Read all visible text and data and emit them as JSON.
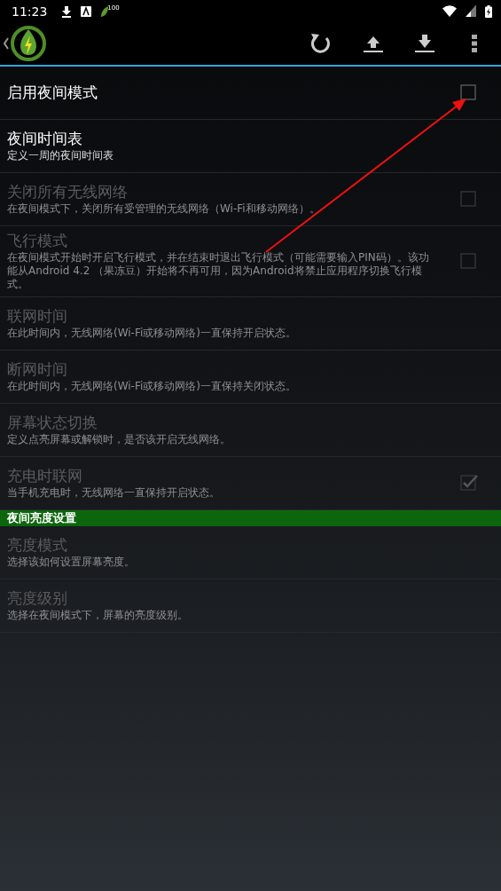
{
  "status_bar": {
    "time": "11:23",
    "badge": "100"
  },
  "sections": [
    {
      "items": [
        {
          "kind": "checkbox",
          "title": "启用夜间模式",
          "disabled": false,
          "checked": false
        },
        {
          "kind": "plain",
          "title": "夜间时间表",
          "summary": "定义一周的夜间时间表",
          "disabled": false
        },
        {
          "kind": "checkbox",
          "title": "关闭所有无线网络",
          "summary": "在夜间模式下，关闭所有受管理的无线网络（Wi-Fi和移动网络）。",
          "disabled": true,
          "checked": false
        },
        {
          "kind": "checkbox",
          "title": "飞行模式",
          "summary": "在夜间模式开始时开启飞行模式，并在结束时退出飞行模式（可能需要输入PIN码）。该功能从Android 4.2 （果冻豆）开始将不再可用，因为Android将禁止应用程序切换飞行模式。",
          "disabled": true,
          "checked": false
        },
        {
          "kind": "plain",
          "title": "联网时间",
          "summary": "在此时间内，无线网络(Wi-Fi或移动网络)一直保持开启状态。",
          "disabled": true
        },
        {
          "kind": "plain",
          "title": "断网时间",
          "summary": "在此时间内，无线网络(Wi-Fi或移动网络)一直保持关闭状态。",
          "disabled": true
        },
        {
          "kind": "plain",
          "title": "屏幕状态切换",
          "summary": "定义点亮屏幕或解锁时，是否该开启无线网络。",
          "disabled": true
        },
        {
          "kind": "checkbox",
          "title": "充电时联网",
          "summary": "当手机充电时，无线网络一直保持开启状态。",
          "disabled": true,
          "checked": true
        }
      ]
    },
    {
      "header": "夜间亮度设置",
      "items": [
        {
          "kind": "plain",
          "title": "亮度模式",
          "summary": "选择该如何设置屏幕亮度。",
          "disabled": true
        },
        {
          "kind": "plain",
          "title": "亮度级别",
          "summary": "选择在夜间模式下，屏幕的亮度级别。",
          "disabled": true
        }
      ]
    }
  ]
}
